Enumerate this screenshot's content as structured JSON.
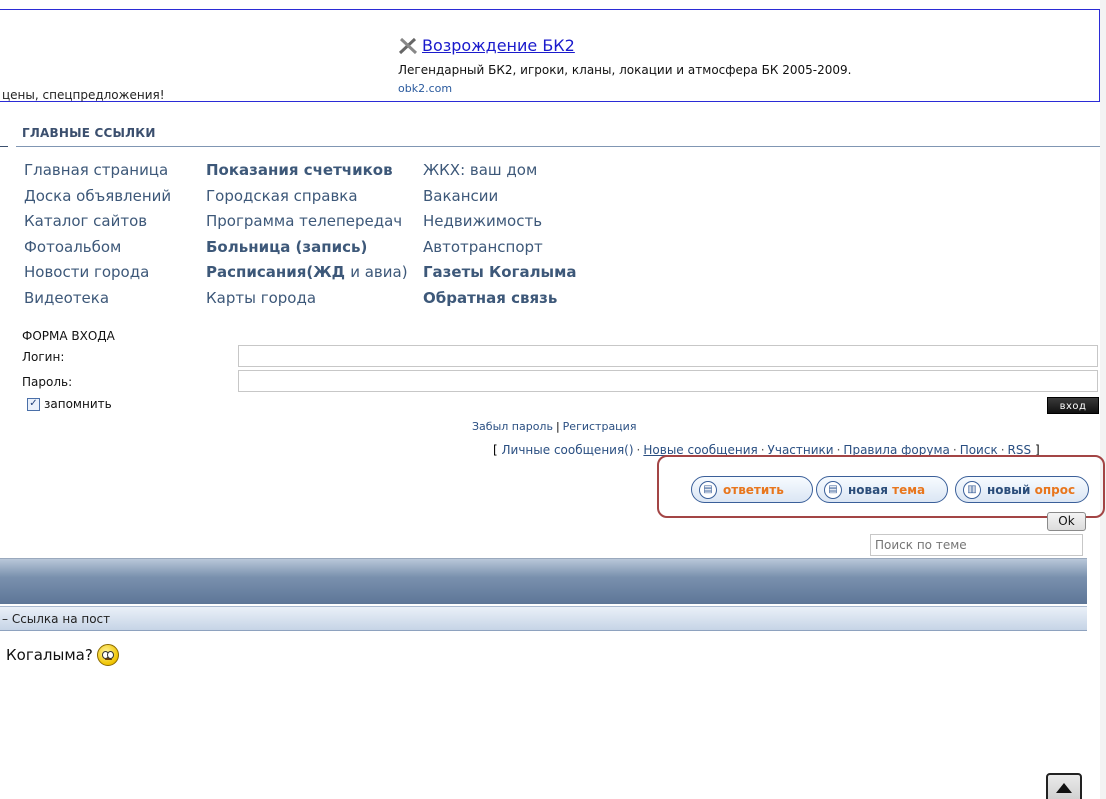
{
  "ad": {
    "left_text": "цены, спецпредложения!",
    "title": "Возрождение БК2",
    "description": "Легендарный БК2, игроки, кланы, локации и атмосфера БК 2005-2009.",
    "url": "obk2.com",
    "icon": "crossed-swords-icon"
  },
  "links": {
    "heading": "ГЛАВНЫЕ ССЫЛКИ",
    "col1": [
      "Главная страница",
      "Доска объявлений",
      "Каталог сайтов",
      "Фотоальбом",
      "Новости города",
      "Видеотека"
    ],
    "col2": [
      "Показания счетчиков",
      "Городская справка",
      "Программа телепередач",
      "Больница (запись)",
      "Расписания(ЖД",
      "и авиа)",
      "Карты города"
    ],
    "col3": [
      "ЖКХ: ваш дом",
      "Вакансии",
      "Недвижимость",
      "Автотранспорт",
      "Газеты Когалыма",
      "Обратная связь"
    ]
  },
  "login": {
    "heading": "ФОРМА ВХОДА",
    "login_label": "Логин:",
    "password_label": "Пароль:",
    "remember_label": "запомнить",
    "remember_checked": true,
    "submit": "вход",
    "forgot": "Забыл пароль",
    "separator": "|",
    "register": "Регистрация"
  },
  "forum_menu": {
    "open": "[",
    "close": "]",
    "items": [
      "Личные сообщения()",
      "Новые сообщения",
      "Участники",
      "Правила форума",
      "Поиск",
      "RSS"
    ]
  },
  "actions": {
    "reply_main": "ответить",
    "topic_part1": "новая",
    "topic_part2": "тема",
    "poll_part1": "новый",
    "poll_part2": "опрос"
  },
  "topic_search": {
    "ok": "Ok",
    "placeholder": "Поиск по теме"
  },
  "post": {
    "header": "– Ссылка на пост",
    "text": "Когалыма?",
    "emoticon": "worried-smiley-icon"
  },
  "colors": {
    "highlight": "#a34545",
    "link": "#3d5879",
    "accent_orange": "#e8761d"
  }
}
